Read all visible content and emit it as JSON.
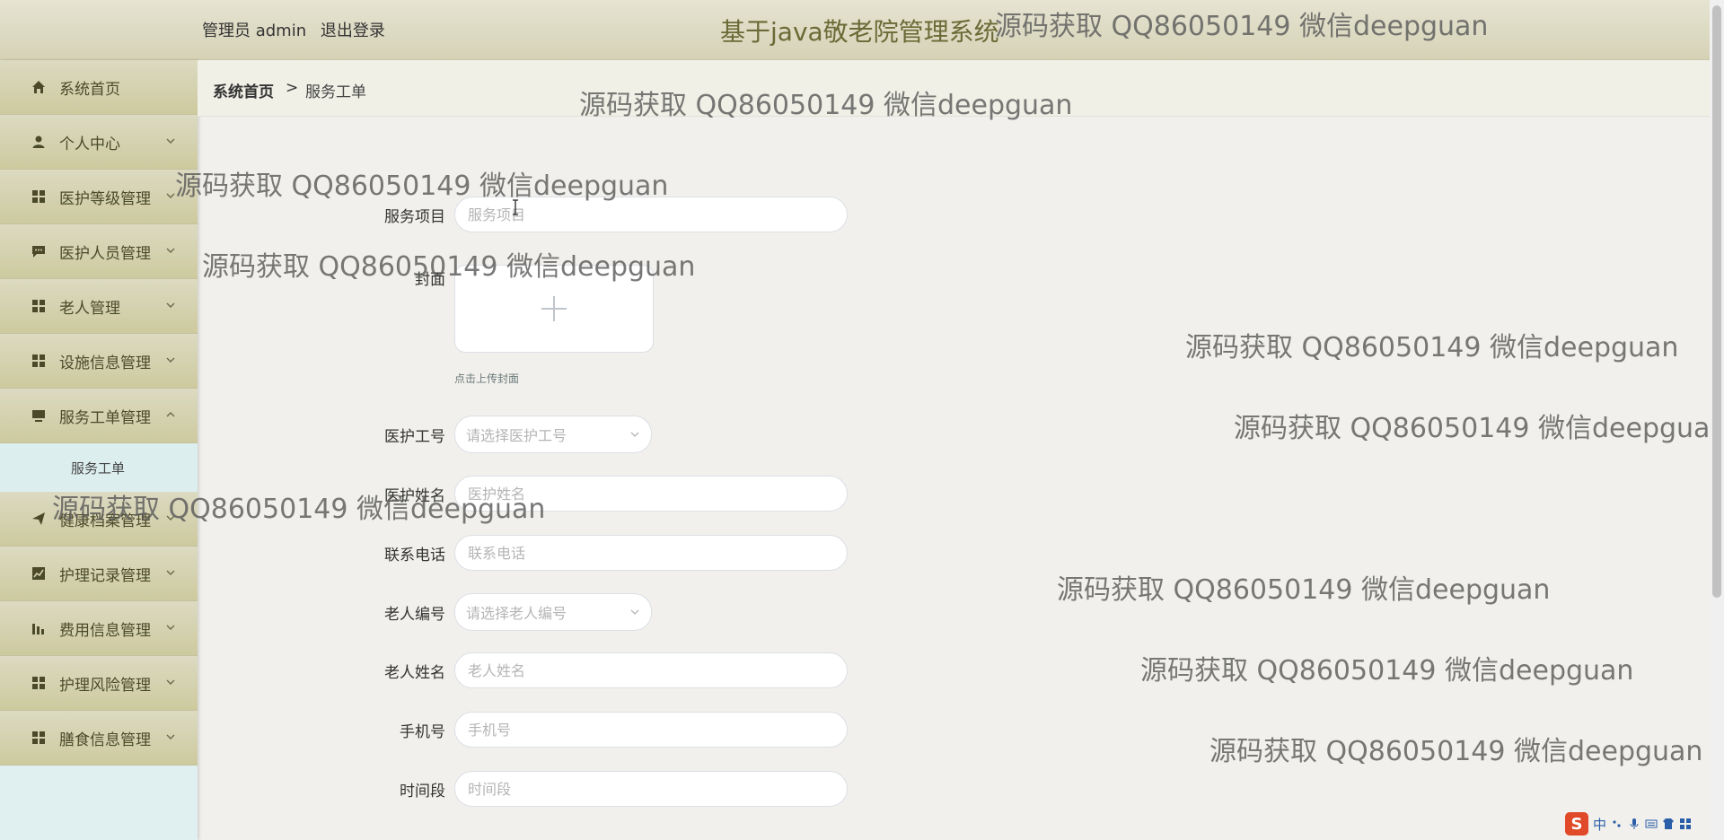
{
  "header": {
    "user_label": "管理员 admin",
    "logout_label": "退出登录",
    "title": "基于java敬老院管理系统"
  },
  "sidebar": {
    "items": [
      {
        "label": "系统首页",
        "icon": "home-icon",
        "has_chevron": false
      },
      {
        "label": "个人中心",
        "icon": "user-icon",
        "has_chevron": true,
        "chevron": "down"
      },
      {
        "label": "医护等级管理",
        "icon": "grid-icon",
        "has_chevron": true,
        "chevron": "down"
      },
      {
        "label": "医护人员管理",
        "icon": "chat-icon",
        "has_chevron": true,
        "chevron": "down"
      },
      {
        "label": "老人管理",
        "icon": "grid-icon",
        "has_chevron": true,
        "chevron": "down"
      },
      {
        "label": "设施信息管理",
        "icon": "grid-icon",
        "has_chevron": true,
        "chevron": "down"
      },
      {
        "label": "服务工单管理",
        "icon": "monitor-icon",
        "has_chevron": true,
        "chevron": "up"
      },
      {
        "label": "健康档案管理",
        "icon": "send-icon",
        "has_chevron": true,
        "chevron": "down"
      },
      {
        "label": "护理记录管理",
        "icon": "line-chart-icon",
        "has_chevron": true,
        "chevron": "down"
      },
      {
        "label": "费用信息管理",
        "icon": "bar-chart-icon",
        "has_chevron": true,
        "chevron": "down"
      },
      {
        "label": "护理风险管理",
        "icon": "grid-icon",
        "has_chevron": true,
        "chevron": "down"
      },
      {
        "label": "膳食信息管理",
        "icon": "grid-icon",
        "has_chevron": true,
        "chevron": "down"
      }
    ],
    "active_submenu": "服务工单"
  },
  "breadcrumb": {
    "home": "系统首页",
    "separator": ">",
    "current": "服务工单"
  },
  "form": {
    "service_item": {
      "label": "服务项目",
      "placeholder": "服务项目"
    },
    "cover": {
      "label": "封面",
      "hint": "点击上传封面"
    },
    "staff_no": {
      "label": "医护工号",
      "placeholder": "请选择医护工号"
    },
    "staff_name": {
      "label": "医护姓名",
      "placeholder": "医护姓名"
    },
    "phone": {
      "label": "联系电话",
      "placeholder": "联系电话"
    },
    "elder_no": {
      "label": "老人编号",
      "placeholder": "请选择老人编号"
    },
    "elder_name": {
      "label": "老人姓名",
      "placeholder": "老人姓名"
    },
    "mobile": {
      "label": "手机号",
      "placeholder": "手机号"
    },
    "time_slot": {
      "label": "时间段",
      "placeholder": "时间段"
    }
  },
  "watermark_text": "源码获取 QQ86050149 微信deepguan",
  "ime": {
    "logo": "S",
    "lang": "中"
  },
  "colors": {
    "header_bg": "#dcd9bf",
    "menu_bg": "#d4d1ae",
    "menu_text": "#4a4a2a",
    "submenu_bg": "#ddeeee",
    "title_color": "#6a6a36",
    "ime_red": "#e04a28"
  }
}
